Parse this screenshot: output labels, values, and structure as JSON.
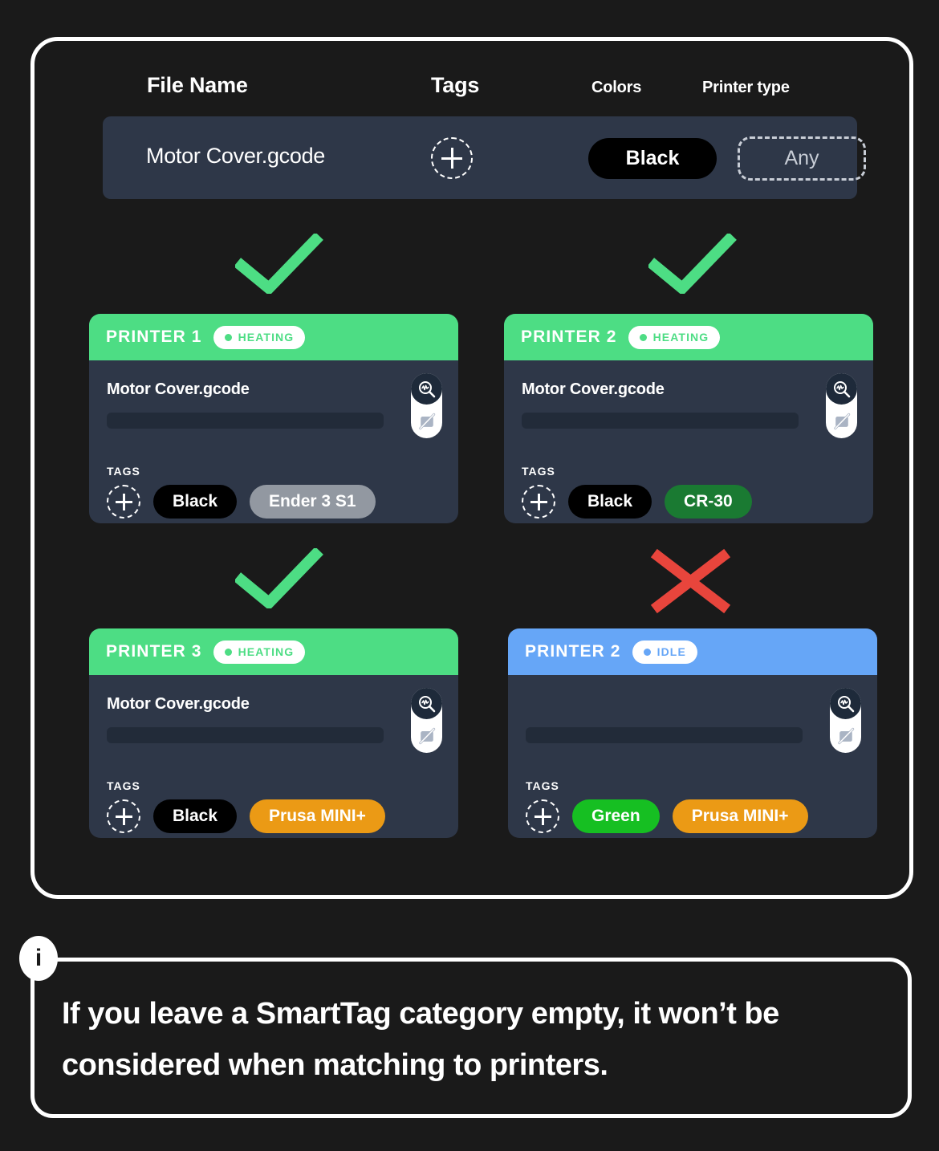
{
  "theme": {
    "background": "#1a1a1a",
    "frame_border": "#ffffff",
    "card_body": "#2e3748",
    "row_background": "#2e3748",
    "status_heating": "#4ddd84",
    "status_idle": "#66a6f7",
    "check_green": "#4ddd84",
    "cross_red": "#e8453c",
    "tag_black": "#000000",
    "tag_gray": "#9298a1",
    "tag_dark_green": "#1a7a32",
    "tag_orange": "#eb9a15",
    "tag_green": "#16bf22"
  },
  "headers": {
    "file_name": "File Name",
    "tags": "Tags",
    "colors": "Colors",
    "printer_type": "Printer type"
  },
  "file_row": {
    "name": "Motor Cover.gcode",
    "add_tag_label": "+",
    "color_tag": "Black",
    "printer_type_tag": "Any"
  },
  "marks": {
    "match": "check",
    "no_match": "cross"
  },
  "tags_label": "TAGS",
  "printers": [
    {
      "name": "PRINTER 1",
      "status": "HEATING",
      "status_type": "heating",
      "filename": "Motor Cover.gcode",
      "match": true,
      "tags": [
        {
          "label": "Black",
          "style": "black"
        },
        {
          "label": "Ender 3 S1",
          "style": "gray"
        }
      ]
    },
    {
      "name": "PRINTER 2",
      "status": "HEATING",
      "status_type": "heating",
      "filename": "Motor Cover.gcode",
      "match": true,
      "tags": [
        {
          "label": "Black",
          "style": "black"
        },
        {
          "label": "CR-30",
          "style": "dgreen"
        }
      ]
    },
    {
      "name": "PRINTER 3",
      "status": "HEATING",
      "status_type": "heating",
      "filename": "Motor Cover.gcode",
      "match": true,
      "tags": [
        {
          "label": "Black",
          "style": "black"
        },
        {
          "label": "Prusa MINI+",
          "style": "orange"
        }
      ]
    },
    {
      "name": "PRINTER 2",
      "status": "IDLE",
      "status_type": "idle",
      "filename": "",
      "match": false,
      "tags": [
        {
          "label": "Green",
          "style": "green"
        },
        {
          "label": "Prusa MINI+",
          "style": "orange"
        }
      ]
    }
  ],
  "info": {
    "badge": "i",
    "text": "If you leave a SmartTag category empty, it won’t be considered when matching to printers."
  }
}
